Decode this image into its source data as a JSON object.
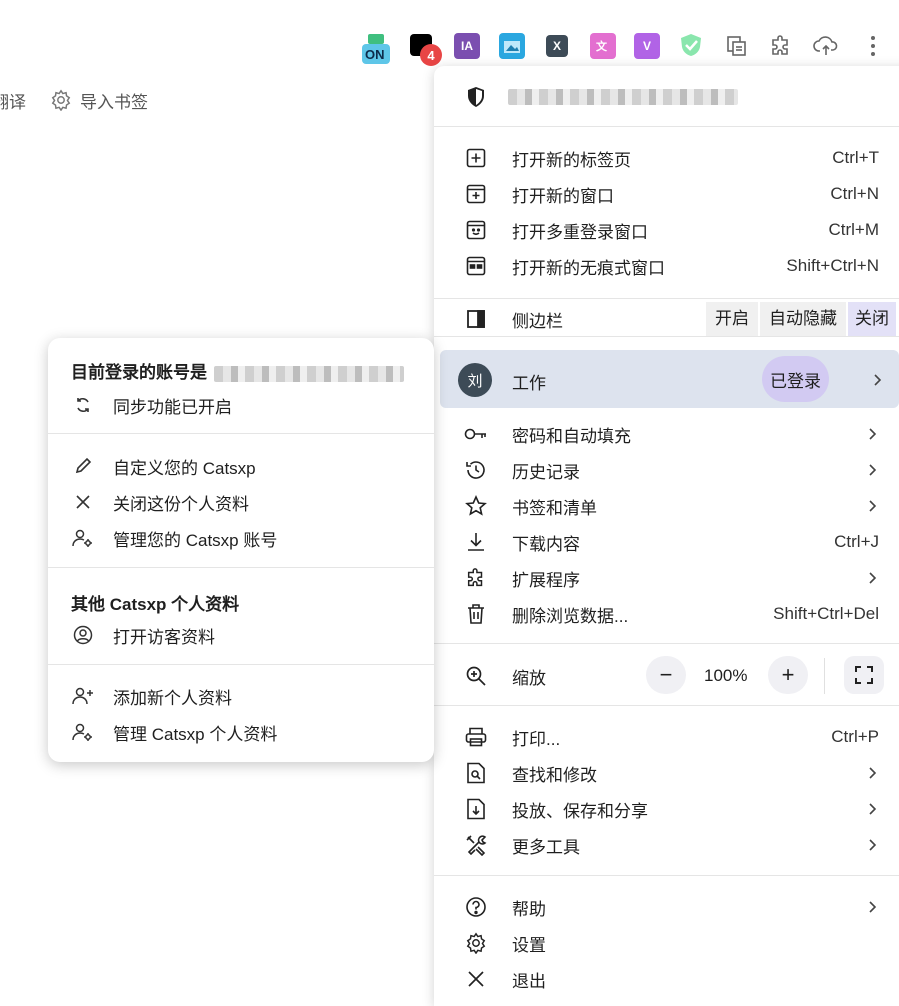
{
  "toolbar": {
    "extensions": [
      {
        "name": "on-extension-icon",
        "text": "ON",
        "bg": "#5ec6e8"
      },
      {
        "name": "notification-extension-icon",
        "badge": "4",
        "bg": "#000000"
      },
      {
        "name": "ia-extension-icon",
        "text": "IA",
        "bg": "#7b4fb0"
      },
      {
        "name": "screenshot-extension-icon",
        "bg": "#2aa7e0"
      },
      {
        "name": "x-extension-icon",
        "text": "X",
        "bg": "#3d4b57"
      },
      {
        "name": "translate-extension-icon",
        "bg": "#e36fd0"
      },
      {
        "name": "v-extension-icon",
        "text": "V",
        "bg": "#b163e6"
      },
      {
        "name": "shield-extension-icon",
        "bg": "#7fe0a3"
      },
      {
        "name": "tab-manager-icon",
        "bg": "#888888"
      },
      {
        "name": "extensions-puzzle-icon",
        "bg": "#888888"
      },
      {
        "name": "cloud-upload-icon",
        "bg": "#888888"
      }
    ]
  },
  "bookmarks_bar": {
    "translate_label": "翻译",
    "import_label": "导入书签"
  },
  "main_menu": {
    "sections": [
      [
        {
          "id": "new-tab",
          "label": "打开新的标签页",
          "shortcut": "Ctrl+T",
          "icon": "new-tab-icon"
        },
        {
          "id": "new-window",
          "label": "打开新的窗口",
          "shortcut": "Ctrl+N",
          "icon": "new-window-icon"
        },
        {
          "id": "multi-login",
          "label": "打开多重登录窗口",
          "shortcut": "Ctrl+M",
          "icon": "multi-login-icon"
        },
        {
          "id": "incognito",
          "label": "打开新的无痕式窗口",
          "shortcut": "Shift+Ctrl+N",
          "icon": "incognito-icon"
        }
      ]
    ],
    "sidebar": {
      "label": "侧边栏",
      "options": [
        "开启",
        "自动隐藏",
        "关闭"
      ],
      "selected": "关闭"
    },
    "profile": {
      "avatar_initial": "刘",
      "name": "工作",
      "status": "已登录"
    },
    "items2": [
      {
        "id": "passwords",
        "label": "密码和自动填充",
        "shortcut": "",
        "submenu": true,
        "icon": "key-icon"
      },
      {
        "id": "history",
        "label": "历史记录",
        "shortcut": "",
        "submenu": true,
        "icon": "history-icon"
      },
      {
        "id": "bookmarks",
        "label": "书签和清单",
        "shortcut": "",
        "submenu": true,
        "icon": "star-icon"
      },
      {
        "id": "downloads",
        "label": "下载内容",
        "shortcut": "Ctrl+J",
        "submenu": false,
        "icon": "download-icon"
      },
      {
        "id": "extensions",
        "label": "扩展程序",
        "shortcut": "",
        "submenu": true,
        "icon": "puzzle-icon"
      },
      {
        "id": "clear-data",
        "label": "删除浏览数据...",
        "shortcut": "Shift+Ctrl+Del",
        "submenu": false,
        "icon": "trash-icon"
      }
    ],
    "zoom": {
      "label": "缩放",
      "minus": "−",
      "value": "100%",
      "plus": "+"
    },
    "items3": [
      {
        "id": "print",
        "label": "打印...",
        "shortcut": "Ctrl+P",
        "submenu": false,
        "icon": "printer-icon"
      },
      {
        "id": "find",
        "label": "查找和修改",
        "shortcut": "",
        "submenu": true,
        "icon": "find-icon"
      },
      {
        "id": "cast",
        "label": "投放、保存和分享",
        "shortcut": "",
        "submenu": true,
        "icon": "cast-save-icon"
      },
      {
        "id": "more-tools",
        "label": "更多工具",
        "shortcut": "",
        "submenu": true,
        "icon": "tools-icon"
      }
    ],
    "items4": [
      {
        "id": "help",
        "label": "帮助",
        "shortcut": "",
        "submenu": true,
        "icon": "help-icon"
      },
      {
        "id": "settings",
        "label": "设置",
        "shortcut": "",
        "submenu": false,
        "icon": "gear-icon"
      },
      {
        "id": "exit",
        "label": "退出",
        "shortcut": "",
        "submenu": false,
        "icon": "close-icon"
      }
    ]
  },
  "profile_menu": {
    "account_heading": "目前登录的账号是",
    "sync_label": "同步功能已开启",
    "customize_label": "自定义您的 Catsxp",
    "close_profile_label": "关闭这份个人资料",
    "manage_account_label": "管理您的 Catsxp 账号",
    "other_heading": "其他 Catsxp 个人资料",
    "guest_label": "打开访客资料",
    "add_profile_label": "添加新个人资料",
    "manage_profiles_label": "管理 Catsxp 个人资料"
  }
}
